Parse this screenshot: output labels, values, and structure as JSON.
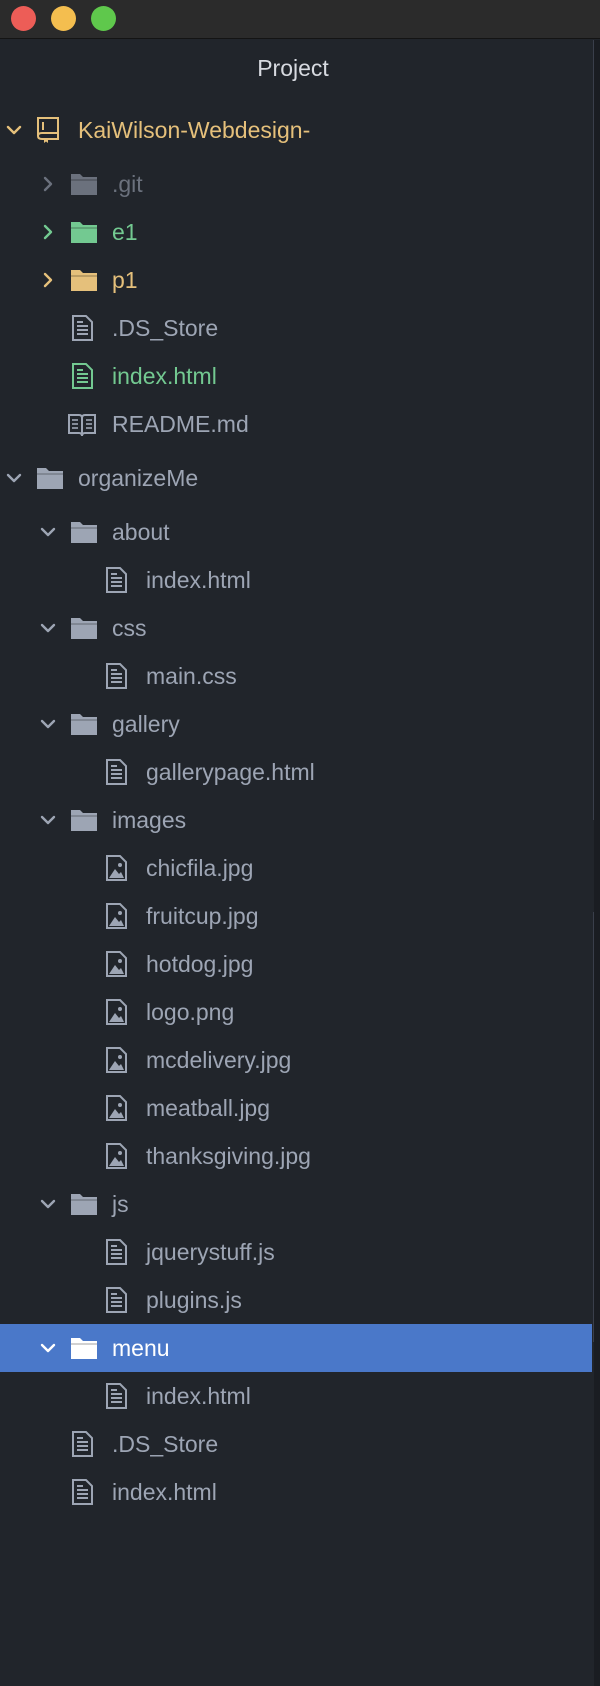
{
  "window": {
    "panel_title": "Project"
  },
  "tree": {
    "root1": {
      "label": "KaiWilson-Webdesign-",
      "children": [
        {
          "label": ".git"
        },
        {
          "label": "e1"
        },
        {
          "label": "p1"
        },
        {
          "label": ".DS_Store"
        },
        {
          "label": "index.html"
        },
        {
          "label": "README.md"
        }
      ]
    },
    "root2": {
      "label": "organizeMe",
      "folders": {
        "about": {
          "label": "about",
          "files": [
            "index.html"
          ]
        },
        "css": {
          "label": "css",
          "files": [
            "main.css"
          ]
        },
        "gallery": {
          "label": "gallery",
          "files": [
            "gallerypage.html"
          ]
        },
        "images": {
          "label": "images",
          "files": [
            "chicfila.jpg",
            "fruitcup.jpg",
            "hotdog.jpg",
            "logo.png",
            "mcdelivery.jpg",
            "meatball.jpg",
            "thanksgiving.jpg"
          ]
        },
        "js": {
          "label": "js",
          "files": [
            "jquerystuff.js",
            "plugins.js"
          ]
        },
        "menu": {
          "label": "menu",
          "files": [
            "index.html"
          ]
        }
      },
      "files": [
        ".DS_Store",
        "index.html"
      ]
    }
  },
  "colors": {
    "background": "#21252b",
    "selection": "#4a78c9",
    "modified": "#e5c07b",
    "added": "#73c991",
    "ignored": "#6b717d",
    "text": "#9da5b4"
  }
}
